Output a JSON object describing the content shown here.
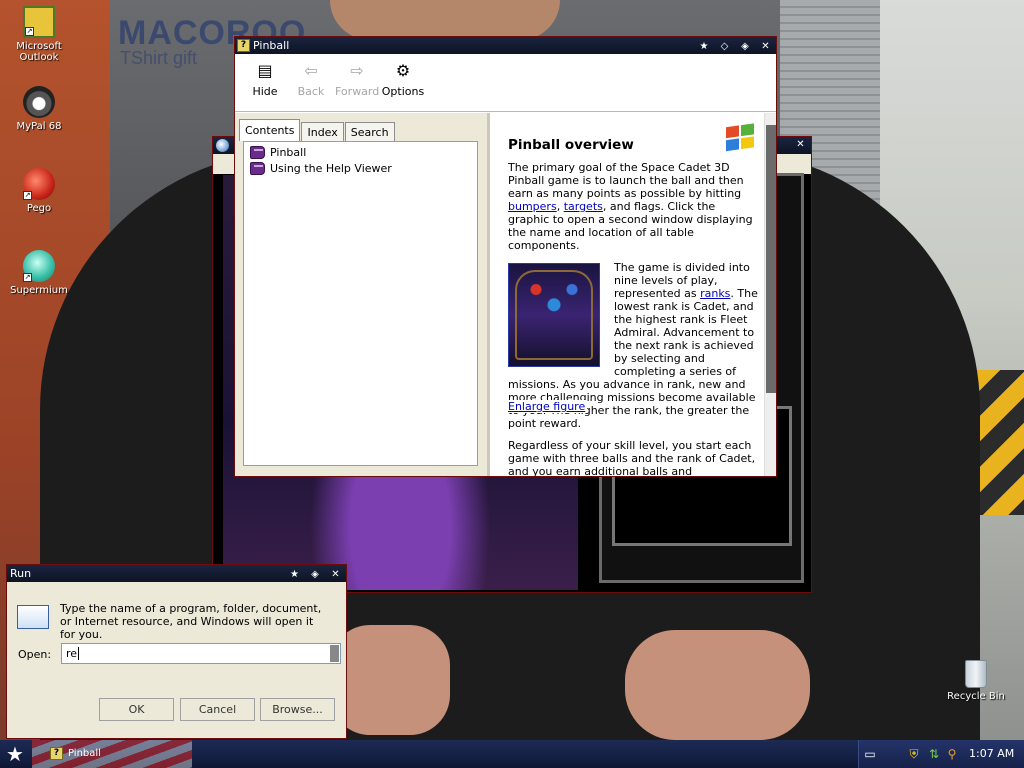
{
  "wallpaper": {
    "brand": "MACOROO",
    "tagline": "TShirt gift"
  },
  "desktop_icons": [
    {
      "label": "Microsoft Outlook"
    },
    {
      "label": "MyPal 68"
    },
    {
      "label": "Pego"
    },
    {
      "label": "Supermium"
    },
    {
      "label": "Recycle Bin"
    }
  ],
  "help_window": {
    "title": "Pinball",
    "toolbar": {
      "hide": "Hide",
      "back": "Back",
      "forward": "Forward",
      "options": "Options"
    },
    "tabs": [
      "Contents",
      "Index",
      "Search"
    ],
    "tree": [
      "Pinball",
      "Using the Help Viewer"
    ],
    "heading": "Pinball overview",
    "para1_start": "The primary goal of the Space Cadet 3D Pinball game is to launch the ball and then earn as many points as possible by hitting ",
    "link_bumpers": "bumpers",
    "sep1": ", ",
    "link_targets": "targets",
    "para1_end": ", and flags. Click the graphic to open a second window displaying the name and location of all table components.",
    "para2_start": "The game is divided into nine levels of play, represented as ",
    "link_ranks": "ranks",
    "para2_end": ". The lowest rank is Cadet, and the highest rank is Fleet Admiral. Advancement to the next rank is achieved by selecting and completing a series of missions. As you advance in rank, new and more challenging missions become available to you. The higher the rank, the greater the point reward.",
    "enlarge": "Enlarge figure",
    "para3": "Regardless of your skill level, you start each game with three balls and the rank of Cadet, and you earn additional balls and"
  },
  "run_dialog": {
    "title": "Run",
    "message": "Type the name of a program, folder, document, or Internet resource, and Windows will open it for you.",
    "open_label": "Open:",
    "open_value": "re",
    "ok": "OK",
    "cancel": "Cancel",
    "browse": "Browse..."
  },
  "taskbar": {
    "task_label": "Pinball",
    "clock": "1:07 AM"
  }
}
